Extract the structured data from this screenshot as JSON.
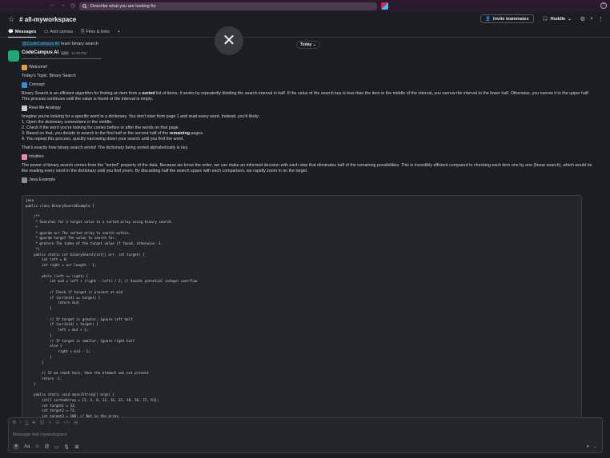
{
  "search": {
    "placeholder": "Describe what you are looking for"
  },
  "channel": {
    "name": "# all-myworkspace"
  },
  "header": {
    "invite_label": "Invite teammates",
    "huddle_label": "Huddle"
  },
  "tabs": [
    {
      "label": "Messages"
    },
    {
      "label": "Add canvas"
    },
    {
      "label": "Files & links"
    }
  ],
  "feed": {
    "quote_mention": "@CodeCampus AI",
    "quote_text": " learn binary search",
    "date_label": "Today",
    "author": "CodeCampus AI",
    "app_badge": "APP",
    "time": "11:30 PM"
  },
  "message": {
    "welcome": "Welcome!",
    "topic": "Today's Topic: Binary Search",
    "concept_head": "Concept",
    "concept_p1": "Binary Search is an efficient algorithm for finding an item from a ",
    "concept_bold": "sorted",
    "concept_p2": " list of items. It works by repeatedly dividing the search interval in half. If the value of the search key is less than the item in the middle of the interval, you narrow the interval to the lower half. Otherwise, you narrow it to the upper half. This process continues until the value is found or the interval is empty.",
    "analogy_head": "Real-life Analogy",
    "analogy_intro": "Imagine you're looking for a specific word in a dictionary. You don't start from page 1 and read every word. Instead, you'd likely:",
    "steps": [
      "1.  Open the dictionary somewhere in the middle.",
      "2.  Check if the word you're looking for comes before or after the words on that page.",
      "3.  Based on that, you decide to search in the first half or the second half of the ",
      "4.  You repeat this process, quickly narrowing down your search until you find the word."
    ],
    "step3_bold": "remaining",
    "step3_end": " pages.",
    "analogy_outro": "That's exactly how binary search works! The dictionary being sorted alphabetically is key.",
    "intuition_head": "Intuition",
    "intuition_text": "The power of binary search comes from the \"sorted\" property of the data. Because we know the order, we can make an informed decision with each step that eliminates half of the remaining possibilities. This is incredibly efficient compared to checking each item one by one (linear search), which would be like reading every word in the dictionary until you find yours. By discarding half the search space with each comparison, we rapidly zoom in on the target.",
    "java_head": "Java Example"
  },
  "code": "java\npublic class BinarySearchExample {\n\n    /**\n     * Searches for a target value in a sorted array using binary search.\n     *\n     * @param arr The sorted array to search within.\n     * @param target The value to search for.\n     * @return The index of the target value if found, otherwise -1.\n     */\n    public static int binarySearch(int[] arr, int target) {\n        int left = 0;\n        int right = arr.length - 1;\n\n        while (left <= right) {\n            int mid = left + (right - left) / 2; // Avoids potential integer overflow\n\n            // Check if target is present at mid\n            if (arr[mid] == target) {\n                return mid;\n            }\n\n            // If target is greater, ignore left half\n            if (arr[mid] < target) {\n                left = mid + 1;\n            }\n            // If target is smaller, ignore right half\n            else {\n                right = mid - 1;\n            }\n        }\n\n        // If we reach here, then the element was not present\n        return -1;\n    }\n\n    public static void main(String[] args) {\n        int[] sortedArray = {2, 5, 8, 12, 16, 23, 38, 56, 72, 91};\n        int target1 = 23;\n        int target2 = 72;\n        int target3 = 100; // Not in the array",
  "composer": {
    "placeholder": "Message #all-myworkspace"
  },
  "colors": {
    "accent_green": "#1fa774",
    "topbar": "#2b1a2d"
  }
}
